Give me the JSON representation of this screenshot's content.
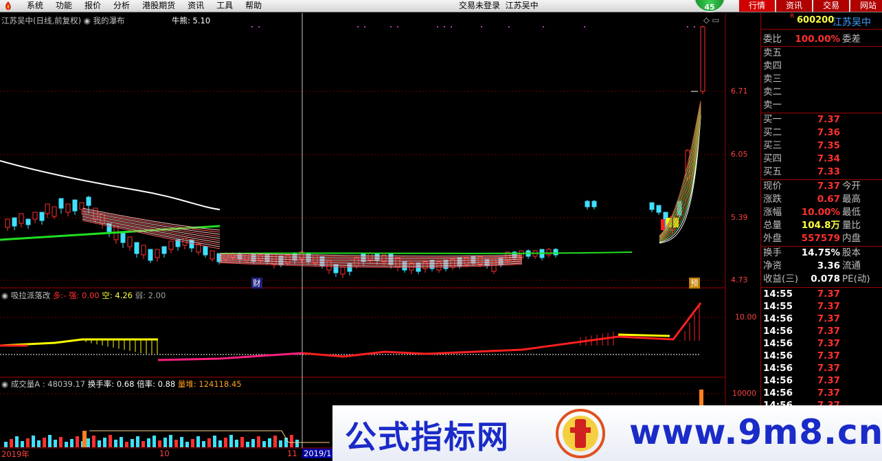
{
  "menubar": {
    "items": [
      "系统",
      "功能",
      "报价",
      "分析",
      "港股期货",
      "资讯",
      "工具",
      "帮助"
    ],
    "status": "交易未登录",
    "stock": "江苏吴中",
    "badge": "45",
    "tabs": [
      "行情",
      "资讯",
      "交易",
      "网站"
    ]
  },
  "main": {
    "title": "江苏吴中(日线,前复权)",
    "indicator": "我的瀑布",
    "bull_bear": "牛熊: 5.10",
    "price_labels": [
      "6.71",
      "6.05",
      "5.39",
      "4.73"
    ],
    "marker_cai": "财",
    "marker_yu": "预"
  },
  "sub1": {
    "title": "吸拉派落改",
    "duo": "多:-",
    "qiang": "强: 0.00",
    "kong": "空: 4.26",
    "ruo": "弱: 2.00",
    "axis": "10.00"
  },
  "sub2": {
    "title": "成交量A : 48039.17",
    "huanshou": "换手率: 0.68",
    "beilv": "倍率: 0.88",
    "liangdui": "量堆: 124118.45",
    "axis": "10000"
  },
  "xaxis": {
    "labels": [
      "2019年",
      "10",
      "11",
      "2019/11"
    ]
  },
  "panel": {
    "code": "600200",
    "name": "江苏吴中",
    "r_mark": "R",
    "weibi": {
      "label": "委比",
      "value": "100.00%",
      "right": "委差"
    },
    "sells": [
      "卖五",
      "卖四",
      "卖三",
      "卖二",
      "卖一"
    ],
    "buys": [
      {
        "label": "买一",
        "price": "7.37"
      },
      {
        "label": "买二",
        "price": "7.36"
      },
      {
        "label": "买三",
        "price": "7.35"
      },
      {
        "label": "买四",
        "price": "7.34"
      },
      {
        "label": "买五",
        "price": "7.33"
      }
    ],
    "stats": [
      {
        "label": "现价",
        "value": "7.37",
        "right": "今开"
      },
      {
        "label": "涨跌",
        "value": "0.67",
        "right": "最高"
      },
      {
        "label": "涨幅",
        "value": "10.00%",
        "right": "最低"
      },
      {
        "label": "总量",
        "value": "104.8万",
        "right": "量比"
      },
      {
        "label": "外盘",
        "value": "557579",
        "right": "内盘"
      }
    ],
    "stats2": [
      {
        "label": "换手",
        "value": "14.75%",
        "right": "股本"
      },
      {
        "label": "净资",
        "value": "3.36",
        "right": "流通"
      },
      {
        "label": "收益(三)",
        "value": "0.078",
        "right": "PE(动)"
      }
    ],
    "ticks": [
      {
        "time": "14:55",
        "price": "7.37"
      },
      {
        "time": "14:55",
        "price": "7.37"
      },
      {
        "time": "14:56",
        "price": "7.37"
      },
      {
        "time": "14:56",
        "price": "7.37"
      },
      {
        "time": "14:56",
        "price": "7.37"
      },
      {
        "time": "14:56",
        "price": "7.37"
      },
      {
        "time": "14:56",
        "price": "7.37"
      },
      {
        "time": "14:56",
        "price": "7.37"
      },
      {
        "time": "14:56",
        "price": "7.37"
      },
      {
        "time": "14:56",
        "price": "7.37"
      },
      {
        "time": "14:56",
        "price": "7.37"
      }
    ]
  },
  "watermark": {
    "left": "公式指标网",
    "right": "www.9m8.cn"
  }
}
